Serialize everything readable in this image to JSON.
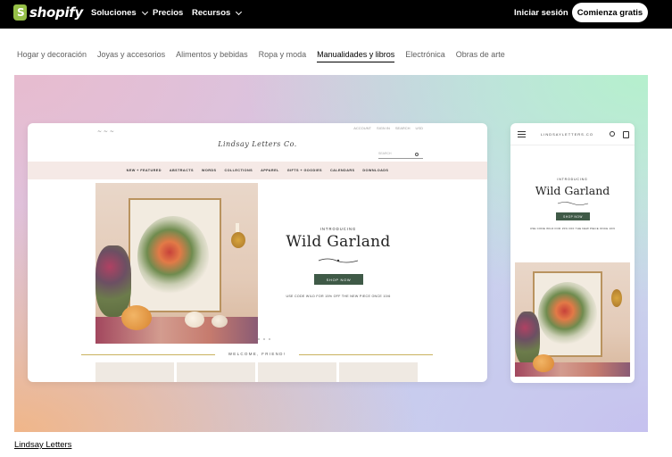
{
  "brand": {
    "name": "shopify"
  },
  "nav": {
    "items": [
      {
        "label": "Soluciones",
        "has_dropdown": true
      },
      {
        "label": "Precios",
        "has_dropdown": false
      },
      {
        "label": "Recursos",
        "has_dropdown": true
      }
    ],
    "login_label": "Iniciar sesión",
    "cta_label": "Comienza gratis"
  },
  "categories": {
    "items": [
      "Hogar y decoración",
      "Joyas y accesorios",
      "Alimentos y bebidas",
      "Ropa y moda",
      "Manualidades y libros",
      "Electrónica",
      "Obras de arte"
    ],
    "active": "Manualidades y libros"
  },
  "desktop_preview": {
    "brand": "Lindsay Letters Co.",
    "utility_links": [
      "ACCOUNT",
      "SIGN IN",
      "SEARCH",
      "USD"
    ],
    "search_placeholder": "SEARCH",
    "menu": [
      "NEW + FEATURED",
      "ABSTRACTS",
      "WORDS",
      "COLLECTIONS",
      "APPAREL",
      "GIFTS + GOODIES",
      "CALENDARS",
      "DOWNLOADS"
    ],
    "intro": "INTRODUCING",
    "title": "Wild Garland",
    "button": "SHOP NOW",
    "promo": "USE CODE WILD FOR 15% OFF THE NEW PIECE ONCE 10/6",
    "welcome": "WELCOME, FRIEND!"
  },
  "mobile_preview": {
    "brand": "LINDSAYLETTERS.CO",
    "intro": "INTRODUCING",
    "title": "Wild Garland",
    "button": "SHOP NOW",
    "promo": "USE CODE WILD FOR 15% OFF THE NEW PIECE ONCE 10/6"
  },
  "caption": "Lindsay Letters",
  "colors": {
    "nav_bg": "#000000",
    "cta_bg": "#ffffff",
    "shop_button": "#3f5a47",
    "menu_band": "#f5e9e6",
    "logo_green": "#95bf47"
  }
}
